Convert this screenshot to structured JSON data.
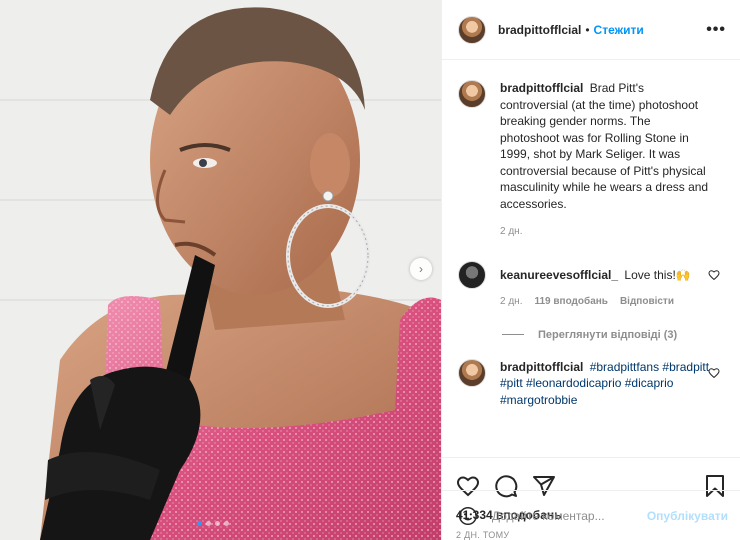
{
  "post": {
    "username": "bradpittofflcial",
    "separator": "•",
    "follow_label": "Стежити",
    "more_label": "•••",
    "photo": {
      "carousel_dots": 4,
      "active_dot": 0,
      "next_arrow": "›"
    }
  },
  "caption": {
    "username": "bradpittofflcial",
    "text": "Brad Pitt's controversial (at the time) photoshoot breaking gender norms. The photoshoot was for Rolling Stone in 1999, shot by Mark Seliger. It was controversial because of Pitt's physical masculinity while he wears a dress and accessories.",
    "time": "2 дн."
  },
  "comments": [
    {
      "username": "keanureevesofflcial_",
      "text": "Love this!🙌",
      "time": "2 дн.",
      "likes": "119 вподобань",
      "reply_label": "Відповісти",
      "view_replies": "Переглянути відповіді (3)"
    },
    {
      "username": "bradpittofflcial",
      "tags": "#bradpittfans #bradpitt #pitt #leonardodicaprio #dicaprio #margotrobbie"
    }
  ],
  "actions": {
    "icons": [
      "heart-icon",
      "comment-icon",
      "share-icon",
      "bookmark-icon"
    ],
    "likes": "41 334 вподобань",
    "date": "2 дн. тому"
  },
  "add_comment": {
    "placeholder": "Додайте коментар...",
    "publish_label": "Опублікувати",
    "emoji_icon": "smiley-icon"
  },
  "colors": {
    "accent": "#0095f6",
    "publish_disabled": "#b2dffc",
    "muted": "#8e8e8e",
    "text": "#262626",
    "dress_pink": "#e0688f"
  }
}
